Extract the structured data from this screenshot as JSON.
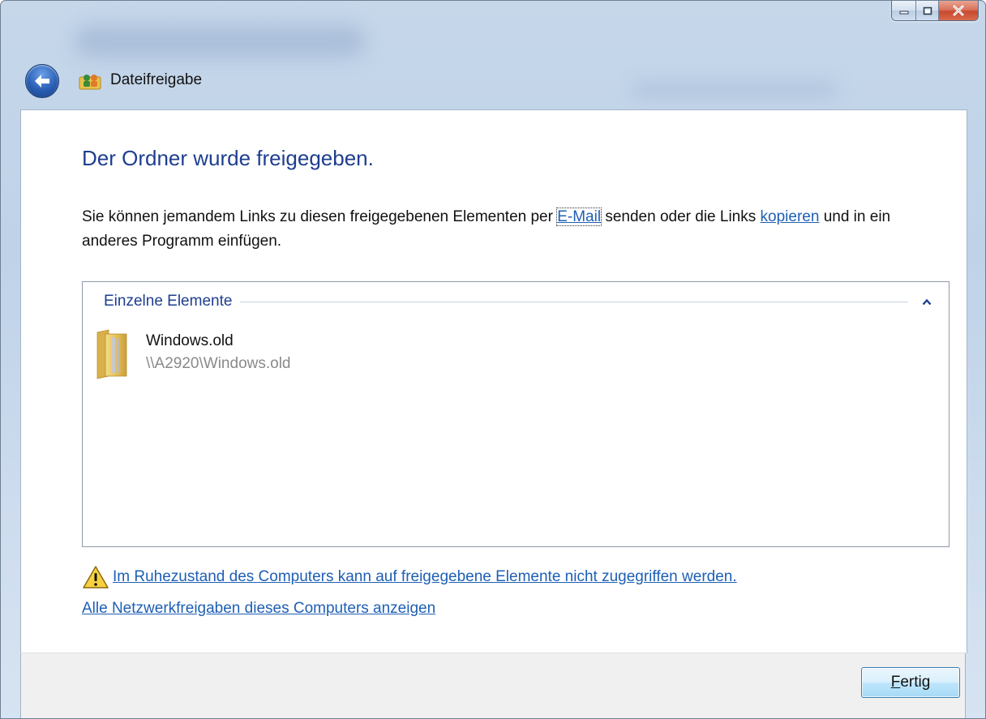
{
  "window": {
    "title": "Dateifreigabe",
    "controls": [
      "minimize-icon",
      "maximize-icon",
      "close-icon"
    ]
  },
  "main": {
    "heading": "Der Ordner wurde freigegeben.",
    "description": {
      "part1": "Sie können jemandem Links zu diesen freigegebenen Elementen per ",
      "email_link": "E-Mail",
      "part2": " senden oder die Links ",
      "copy_link": "kopieren",
      "part3": " und in ein anderes Programm einfügen."
    },
    "group": {
      "label": "Einzelne Elemente",
      "items": [
        {
          "name": "Windows.old",
          "path": "\\\\A2920\\Windows.old",
          "icon": "folder-icon"
        }
      ]
    },
    "warning_link": "Im Ruhezustand des Computers kann auf freigegebene Elemente nicht zugegriffen werden.",
    "all_shares_link": "Alle Netzwerkfreigaben dieses Computers anzeigen"
  },
  "footer": {
    "done_button_accel": "F",
    "done_button_rest": "ertig"
  },
  "colors": {
    "heading": "#1e3e8f",
    "link": "#1e5fb4",
    "path_text": "#8a8a8a",
    "footer_bg": "#f0f0f0"
  }
}
